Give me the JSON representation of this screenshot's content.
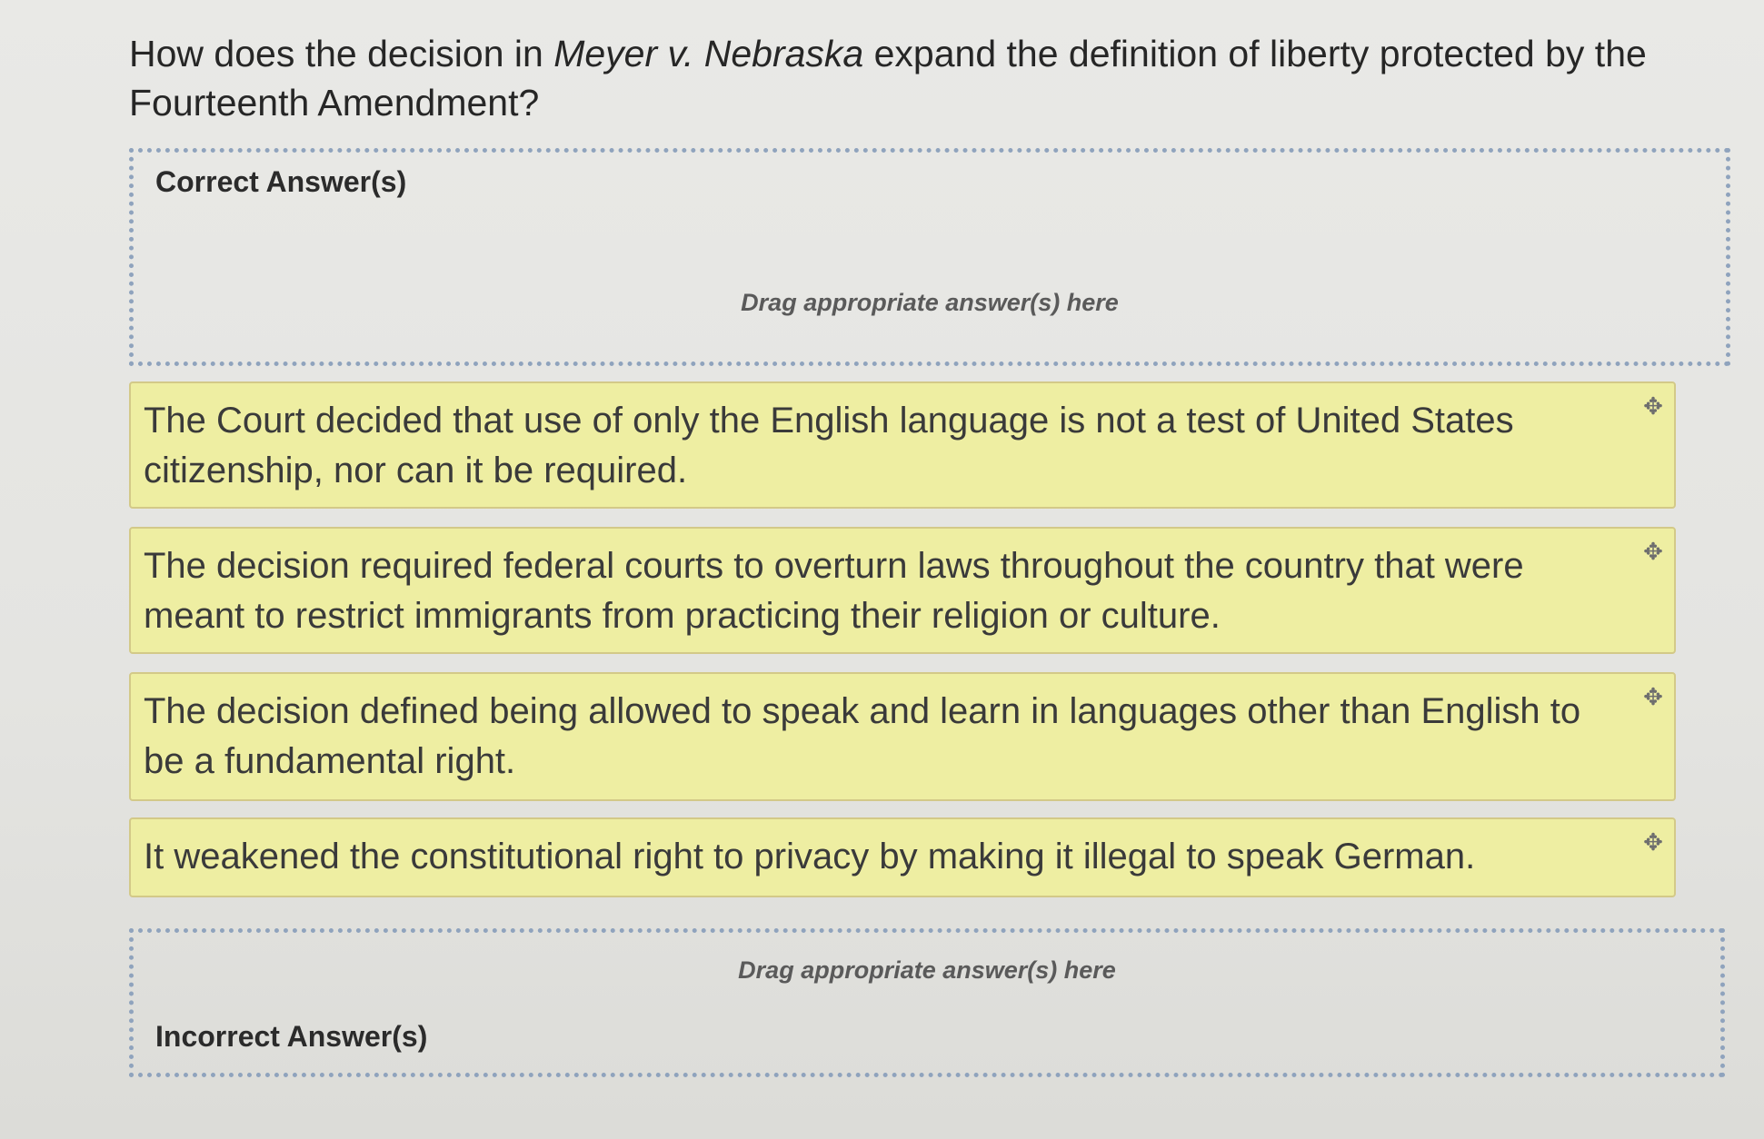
{
  "question": {
    "prefix": "How does the decision in ",
    "case_name": "Meyer v. Nebraska",
    "suffix": " expand the definition of liberty protected by the Fourteenth Amendment?"
  },
  "correct_zone": {
    "label": "Correct Answer(s)",
    "hint": "Drag appropriate answer(s) here"
  },
  "answers": [
    {
      "text": "The Court decided that use of only the English language is not a test of United States citizenship, nor can it be required.",
      "handle_icon": "move-icon"
    },
    {
      "text": "The decision required federal courts to overturn laws throughout the country that were meant to restrict immigrants from practicing their religion or culture.",
      "handle_icon": "move-icon"
    },
    {
      "text": "The decision defined being allowed to speak and learn in languages other than English to be a fundamental right.",
      "handle_icon": "move-icon"
    },
    {
      "text": "It weakened the constitutional right to privacy by making it illegal to speak German.",
      "handle_icon": "move-icon"
    }
  ],
  "incorrect_zone": {
    "label": "Incorrect Answer(s)",
    "hint": "Drag appropriate answer(s) here"
  },
  "colors": {
    "answer_bg": "#eeeea2",
    "answer_border": "#d3c988",
    "dropzone_border": "#8fa3bd"
  }
}
